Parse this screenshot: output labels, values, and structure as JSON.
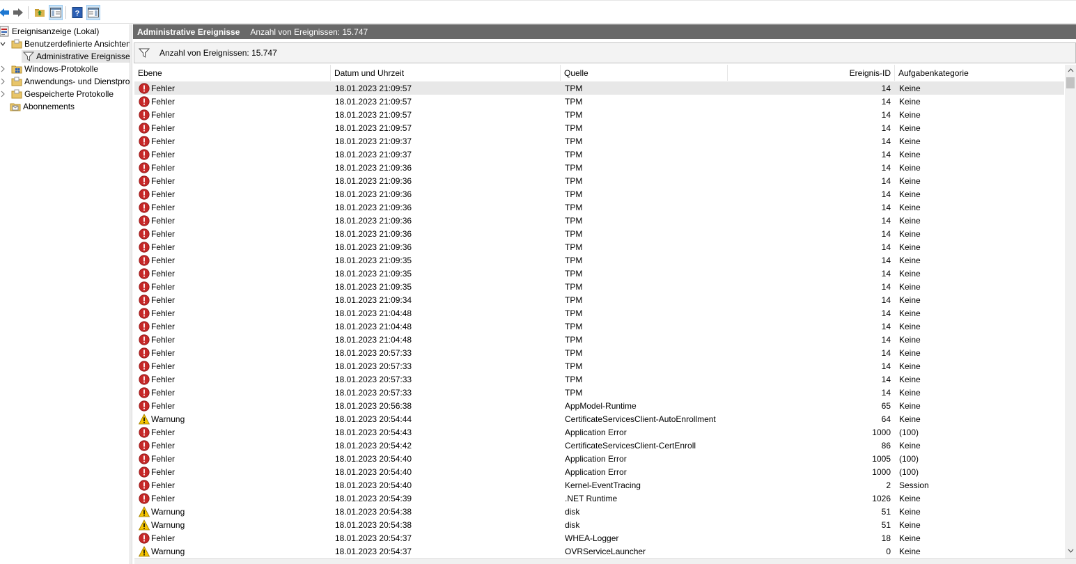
{
  "toolbar": {
    "buttons": [
      "back-arrow-icon",
      "forward-arrow-icon",
      "up-folder-icon",
      "show-hide-tree-icon",
      "help-icon",
      "show-hide-action-pane-icon"
    ]
  },
  "tree": {
    "items": [
      {
        "label": "Ereignisanzeige (Lokal)"
      },
      {
        "label": "Benutzerdefinierte Ansichten"
      },
      {
        "label": "Administrative Ereignisse"
      },
      {
        "label": "Windows-Protokolle"
      },
      {
        "label": "Anwendungs- und Dienstprotokolle"
      },
      {
        "label": "Gespeicherte Protokolle"
      },
      {
        "label": "Abonnements"
      }
    ]
  },
  "header": {
    "title": "Administrative Ereignisse",
    "count": "Anzahl von Ereignissen: 15.747"
  },
  "filter": {
    "text": "Anzahl von Ereignissen: 15.747"
  },
  "columns": [
    "Ebene",
    "Datum und Uhrzeit",
    "Quelle",
    "Ereignis-ID",
    "Aufgabenkategorie"
  ],
  "colors": {
    "error": "#c62828",
    "warning": "#f5c400",
    "header_bar": "#696969",
    "selected_row": "#e8e8e8"
  },
  "events": [
    {
      "level": "Fehler",
      "date": "18.01.2023 21:09:57",
      "source": "TPM",
      "id": "14",
      "category": "Keine"
    },
    {
      "level": "Fehler",
      "date": "18.01.2023 21:09:57",
      "source": "TPM",
      "id": "14",
      "category": "Keine"
    },
    {
      "level": "Fehler",
      "date": "18.01.2023 21:09:57",
      "source": "TPM",
      "id": "14",
      "category": "Keine"
    },
    {
      "level": "Fehler",
      "date": "18.01.2023 21:09:57",
      "source": "TPM",
      "id": "14",
      "category": "Keine"
    },
    {
      "level": "Fehler",
      "date": "18.01.2023 21:09:37",
      "source": "TPM",
      "id": "14",
      "category": "Keine"
    },
    {
      "level": "Fehler",
      "date": "18.01.2023 21:09:37",
      "source": "TPM",
      "id": "14",
      "category": "Keine"
    },
    {
      "level": "Fehler",
      "date": "18.01.2023 21:09:36",
      "source": "TPM",
      "id": "14",
      "category": "Keine"
    },
    {
      "level": "Fehler",
      "date": "18.01.2023 21:09:36",
      "source": "TPM",
      "id": "14",
      "category": "Keine"
    },
    {
      "level": "Fehler",
      "date": "18.01.2023 21:09:36",
      "source": "TPM",
      "id": "14",
      "category": "Keine"
    },
    {
      "level": "Fehler",
      "date": "18.01.2023 21:09:36",
      "source": "TPM",
      "id": "14",
      "category": "Keine"
    },
    {
      "level": "Fehler",
      "date": "18.01.2023 21:09:36",
      "source": "TPM",
      "id": "14",
      "category": "Keine"
    },
    {
      "level": "Fehler",
      "date": "18.01.2023 21:09:36",
      "source": "TPM",
      "id": "14",
      "category": "Keine"
    },
    {
      "level": "Fehler",
      "date": "18.01.2023 21:09:36",
      "source": "TPM",
      "id": "14",
      "category": "Keine"
    },
    {
      "level": "Fehler",
      "date": "18.01.2023 21:09:35",
      "source": "TPM",
      "id": "14",
      "category": "Keine"
    },
    {
      "level": "Fehler",
      "date": "18.01.2023 21:09:35",
      "source": "TPM",
      "id": "14",
      "category": "Keine"
    },
    {
      "level": "Fehler",
      "date": "18.01.2023 21:09:35",
      "source": "TPM",
      "id": "14",
      "category": "Keine"
    },
    {
      "level": "Fehler",
      "date": "18.01.2023 21:09:34",
      "source": "TPM",
      "id": "14",
      "category": "Keine"
    },
    {
      "level": "Fehler",
      "date": "18.01.2023 21:04:48",
      "source": "TPM",
      "id": "14",
      "category": "Keine"
    },
    {
      "level": "Fehler",
      "date": "18.01.2023 21:04:48",
      "source": "TPM",
      "id": "14",
      "category": "Keine"
    },
    {
      "level": "Fehler",
      "date": "18.01.2023 21:04:48",
      "source": "TPM",
      "id": "14",
      "category": "Keine"
    },
    {
      "level": "Fehler",
      "date": "18.01.2023 20:57:33",
      "source": "TPM",
      "id": "14",
      "category": "Keine"
    },
    {
      "level": "Fehler",
      "date": "18.01.2023 20:57:33",
      "source": "TPM",
      "id": "14",
      "category": "Keine"
    },
    {
      "level": "Fehler",
      "date": "18.01.2023 20:57:33",
      "source": "TPM",
      "id": "14",
      "category": "Keine"
    },
    {
      "level": "Fehler",
      "date": "18.01.2023 20:57:33",
      "source": "TPM",
      "id": "14",
      "category": "Keine"
    },
    {
      "level": "Fehler",
      "date": "18.01.2023 20:56:38",
      "source": "AppModel-Runtime",
      "id": "65",
      "category": "Keine"
    },
    {
      "level": "Warnung",
      "date": "18.01.2023 20:54:44",
      "source": "CertificateServicesClient-AutoEnrollment",
      "id": "64",
      "category": "Keine"
    },
    {
      "level": "Fehler",
      "date": "18.01.2023 20:54:43",
      "source": "Application Error",
      "id": "1000",
      "category": "(100)"
    },
    {
      "level": "Fehler",
      "date": "18.01.2023 20:54:42",
      "source": "CertificateServicesClient-CertEnroll",
      "id": "86",
      "category": "Keine"
    },
    {
      "level": "Fehler",
      "date": "18.01.2023 20:54:40",
      "source": "Application Error",
      "id": "1005",
      "category": "(100)"
    },
    {
      "level": "Fehler",
      "date": "18.01.2023 20:54:40",
      "source": "Application Error",
      "id": "1000",
      "category": "(100)"
    },
    {
      "level": "Fehler",
      "date": "18.01.2023 20:54:40",
      "source": "Kernel-EventTracing",
      "id": "2",
      "category": "Session"
    },
    {
      "level": "Fehler",
      "date": "18.01.2023 20:54:39",
      "source": ".NET Runtime",
      "id": "1026",
      "category": "Keine"
    },
    {
      "level": "Warnung",
      "date": "18.01.2023 20:54:38",
      "source": "disk",
      "id": "51",
      "category": "Keine"
    },
    {
      "level": "Warnung",
      "date": "18.01.2023 20:54:38",
      "source": "disk",
      "id": "51",
      "category": "Keine"
    },
    {
      "level": "Fehler",
      "date": "18.01.2023 20:54:37",
      "source": "WHEA-Logger",
      "id": "18",
      "category": "Keine"
    },
    {
      "level": "Warnung",
      "date": "18.01.2023 20:54:37",
      "source": "OVRServiceLauncher",
      "id": "0",
      "category": "Keine"
    }
  ]
}
